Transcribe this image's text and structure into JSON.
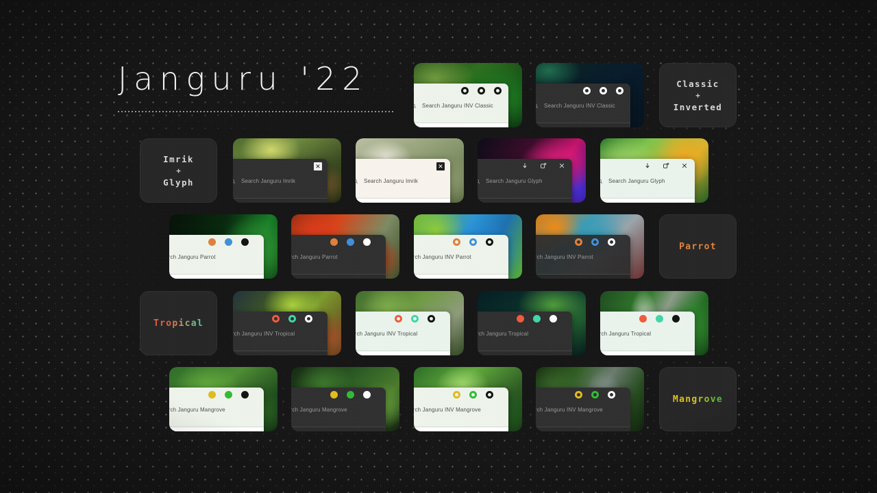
{
  "page": {
    "title": "Janguru '22",
    "background_color": "#141414",
    "panel_light": "#edf3ea",
    "panel_dark": "#2e2e2e"
  },
  "labels": {
    "classic_inverted": {
      "line1": "Classic",
      "plus": "+",
      "line2": "Inverted"
    },
    "imrik_glyph": {
      "line1": "Imrik",
      "plus": "+",
      "line2": "Glyph"
    },
    "parrot": {
      "text": "Parrot",
      "color": "#e2803c"
    },
    "tropical": {
      "text": "Tropical",
      "color_start": "#ef5a3a",
      "color_end": "#3fd6a8"
    },
    "mangrove": {
      "text": "Mangrove",
      "color_start": "#e5c21e",
      "color_end": "#3bbd3b"
    }
  },
  "rows": [
    {
      "name": "classic",
      "cards": [
        {
          "search": "Search Janguru INV Classic",
          "icons": [
            "dot-ring-black",
            "dot-ring-black",
            "dot-ring-black"
          ],
          "theme": "light"
        },
        {
          "search": "Search Janguru INV Classic",
          "icons": [
            "dot-ring-white",
            "dot-ring-white",
            "dot-ring-white"
          ],
          "theme": "dark"
        }
      ]
    },
    {
      "name": "imrik-glyph",
      "cards": [
        {
          "search": "Search Janguru Imrik",
          "icons": [
            "close-box-light"
          ],
          "theme": "dark"
        },
        {
          "search": "Search Janguru Imrik",
          "icons": [
            "close-box-dark"
          ],
          "theme": "light"
        },
        {
          "search": "Search Janguru Glyph",
          "icons": [
            "download-icon",
            "new-window-icon",
            "close-icon"
          ],
          "theme": "dark"
        },
        {
          "search": "Search Janguru Glyph",
          "icons": [
            "download-icon",
            "new-window-icon",
            "close-icon"
          ],
          "theme": "light"
        }
      ]
    },
    {
      "name": "parrot",
      "cards": [
        {
          "search": "Search Janguru Parrot",
          "icons": [
            "dot-orange",
            "dot-blue",
            "dot-black"
          ],
          "theme": "light"
        },
        {
          "search": "Search Janguru Parrot",
          "icons": [
            "dot-orange",
            "dot-blue",
            "dot-white"
          ],
          "theme": "dark"
        },
        {
          "search": "Search Janguru INV Parrot",
          "icons": [
            "ring-orange",
            "ring-blue",
            "ring-black"
          ],
          "theme": "light"
        },
        {
          "search": "Search Janguru INV Parrot",
          "icons": [
            "ring-orange",
            "ring-blue",
            "ring-white"
          ],
          "theme": "dark"
        }
      ]
    },
    {
      "name": "tropical",
      "cards": [
        {
          "search": "Search Janguru INV Tropical",
          "icons": [
            "ring-red",
            "ring-teal",
            "ring-white"
          ],
          "theme": "dark"
        },
        {
          "search": "Search Janguru INV Tropical",
          "icons": [
            "ring-red",
            "ring-teal",
            "ring-black"
          ],
          "theme": "light"
        },
        {
          "search": "Search Janguru Tropical",
          "icons": [
            "dot-red",
            "dot-teal",
            "dot-white"
          ],
          "theme": "dark"
        },
        {
          "search": "Search Janguru Tropical",
          "icons": [
            "dot-red",
            "dot-teal",
            "dot-black"
          ],
          "theme": "light"
        }
      ]
    },
    {
      "name": "mangrove",
      "cards": [
        {
          "search": "Search Janguru Mangrove",
          "icons": [
            "dot-gold",
            "dot-green",
            "dot-black"
          ],
          "theme": "light"
        },
        {
          "search": "Search Janguru Mangrove",
          "icons": [
            "dot-gold",
            "dot-green",
            "dot-white"
          ],
          "theme": "dark"
        },
        {
          "search": "Search Janguru INV Mangrove",
          "icons": [
            "ring-gold",
            "ring-green",
            "ring-black"
          ],
          "theme": "light"
        },
        {
          "search": "Search Janguru INV Mangrove",
          "icons": [
            "ring-gold",
            "ring-green",
            "ring-white"
          ],
          "theme": "dark"
        }
      ]
    }
  ],
  "icon_colors": {
    "orange": "#df7f3c",
    "blue": "#3e8fd8",
    "black": "#111111",
    "white": "#ffffff",
    "red": "#ef5a3a",
    "teal": "#3fd6a8",
    "gold": "#e0bb1c",
    "green": "#2fbb34"
  }
}
